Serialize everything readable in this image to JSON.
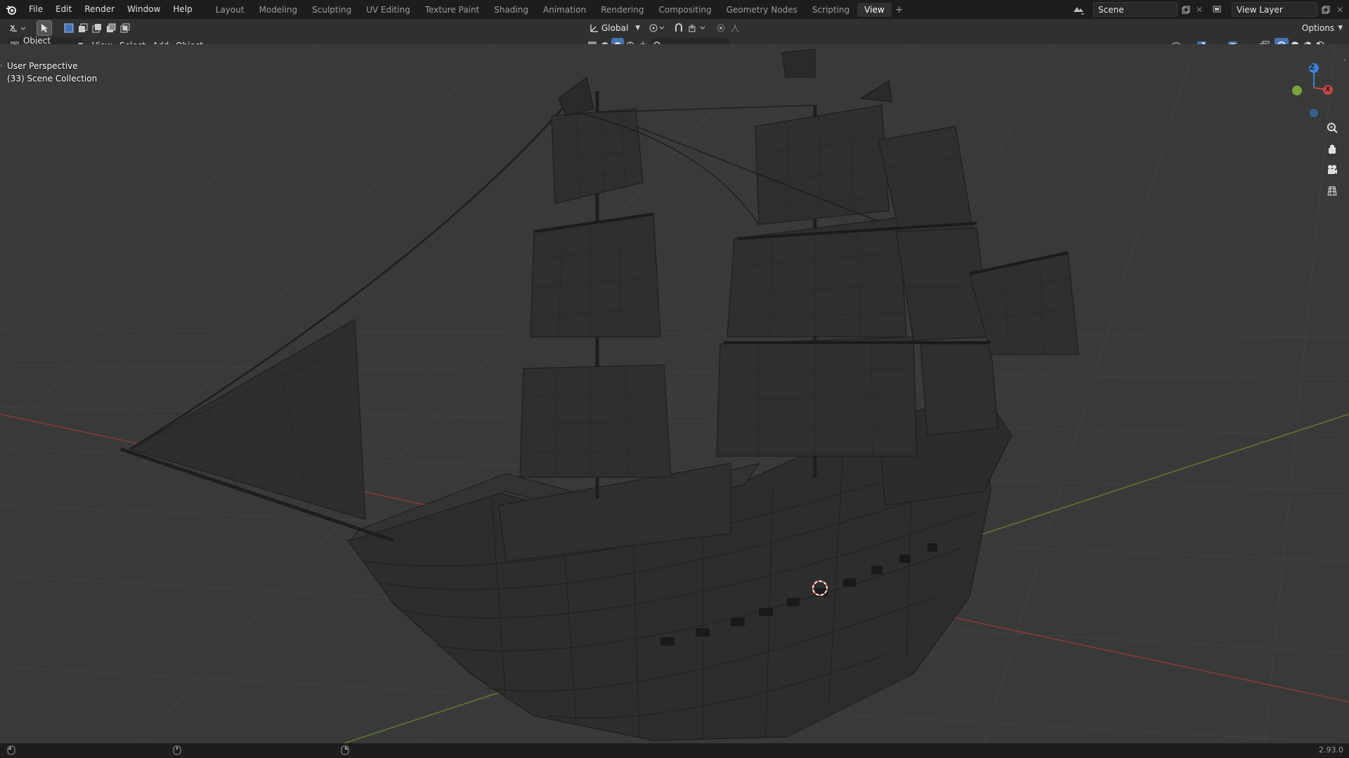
{
  "top_menu": [
    "File",
    "Edit",
    "Render",
    "Window",
    "Help"
  ],
  "workspace_tabs": [
    "Layout",
    "Modeling",
    "Sculpting",
    "UV Editing",
    "Texture Paint",
    "Shading",
    "Animation",
    "Rendering",
    "Compositing",
    "Geometry Nodes",
    "Scripting",
    "View"
  ],
  "active_tab": "View",
  "scene": {
    "label": "Scene"
  },
  "view_layer": {
    "label": "View Layer"
  },
  "header": {
    "mode": "Object Mode",
    "menus": [
      "View",
      "Select",
      "Add",
      "Object"
    ],
    "transform_orientation": "Global",
    "options": "Options"
  },
  "viewport": {
    "perspective_label": "User Perspective",
    "collection_label": "(33) Scene Collection"
  },
  "gizmo": {
    "x": "X",
    "y": "Y",
    "z": "Z"
  },
  "status": {
    "version": "2.93.0"
  },
  "colors": {
    "x_axis": "#c84646",
    "y_axis": "#7aa33d",
    "z_axis": "#3d80d4",
    "selected": "#4772b3"
  }
}
